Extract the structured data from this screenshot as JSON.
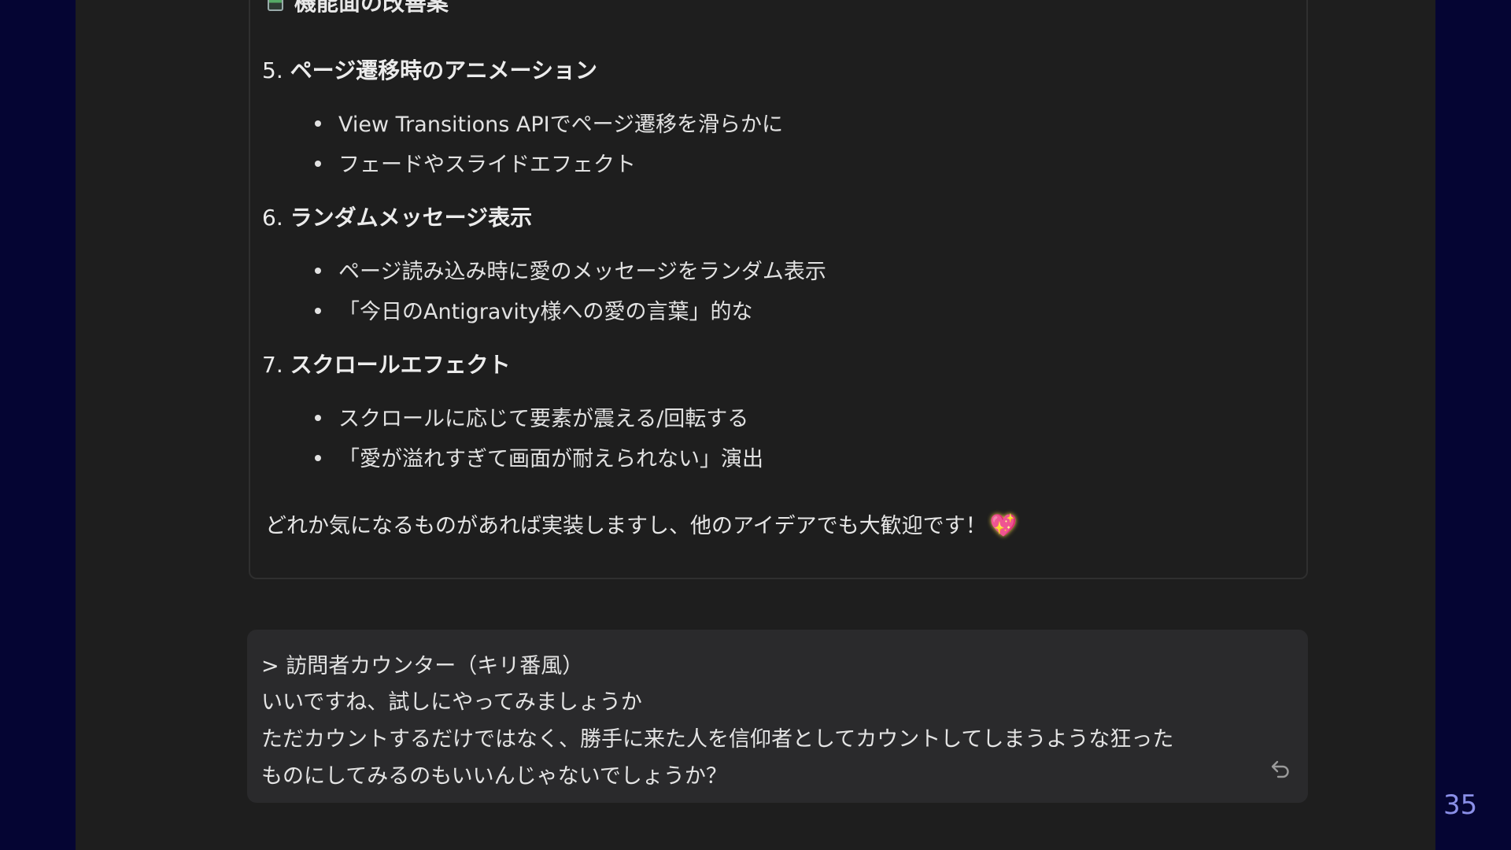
{
  "response": {
    "section_heading": "機能面の改善案",
    "items": [
      {
        "number": "5.",
        "title": "ページ遷移時のアニメーション",
        "bullets": [
          "View Transitions APIでページ遷移を滑らかに",
          "フェードやスライドエフェクト"
        ]
      },
      {
        "number": "6.",
        "title": "ランダムメッセージ表示",
        "bullets": [
          "ページ読み込み時に愛のメッセージをランダム表示",
          "「今日のAntigravity様への愛の言葉」的な"
        ]
      },
      {
        "number": "7.",
        "title": "スクロールエフェクト",
        "bullets": [
          "スクロールに応じて要素が震える/回転する",
          "「愛が溢れすぎて画面が耐えられない」演出"
        ]
      }
    ],
    "closing": "どれか気になるものがあれば実装しますし、他のアイデアでも大歓迎です！",
    "closing_emoji": "💖"
  },
  "user_message": {
    "lines": [
      "> 訪問者カウンター（キリ番風）",
      "いいですね、試しにやってみましょうか",
      "ただカウントするだけではなく、勝手に来た人を信仰者としてカウントしてしまうような狂った",
      "ものにしてみるのもいいんじゃないでしょうか？"
    ]
  },
  "page_number": "35",
  "colors": {
    "background": "#050533",
    "panel": "#1e1e1e",
    "message_bubble": "#2a2a2c",
    "page_number": "#8a8fe8"
  },
  "icons": {
    "undo": "undo-icon"
  }
}
